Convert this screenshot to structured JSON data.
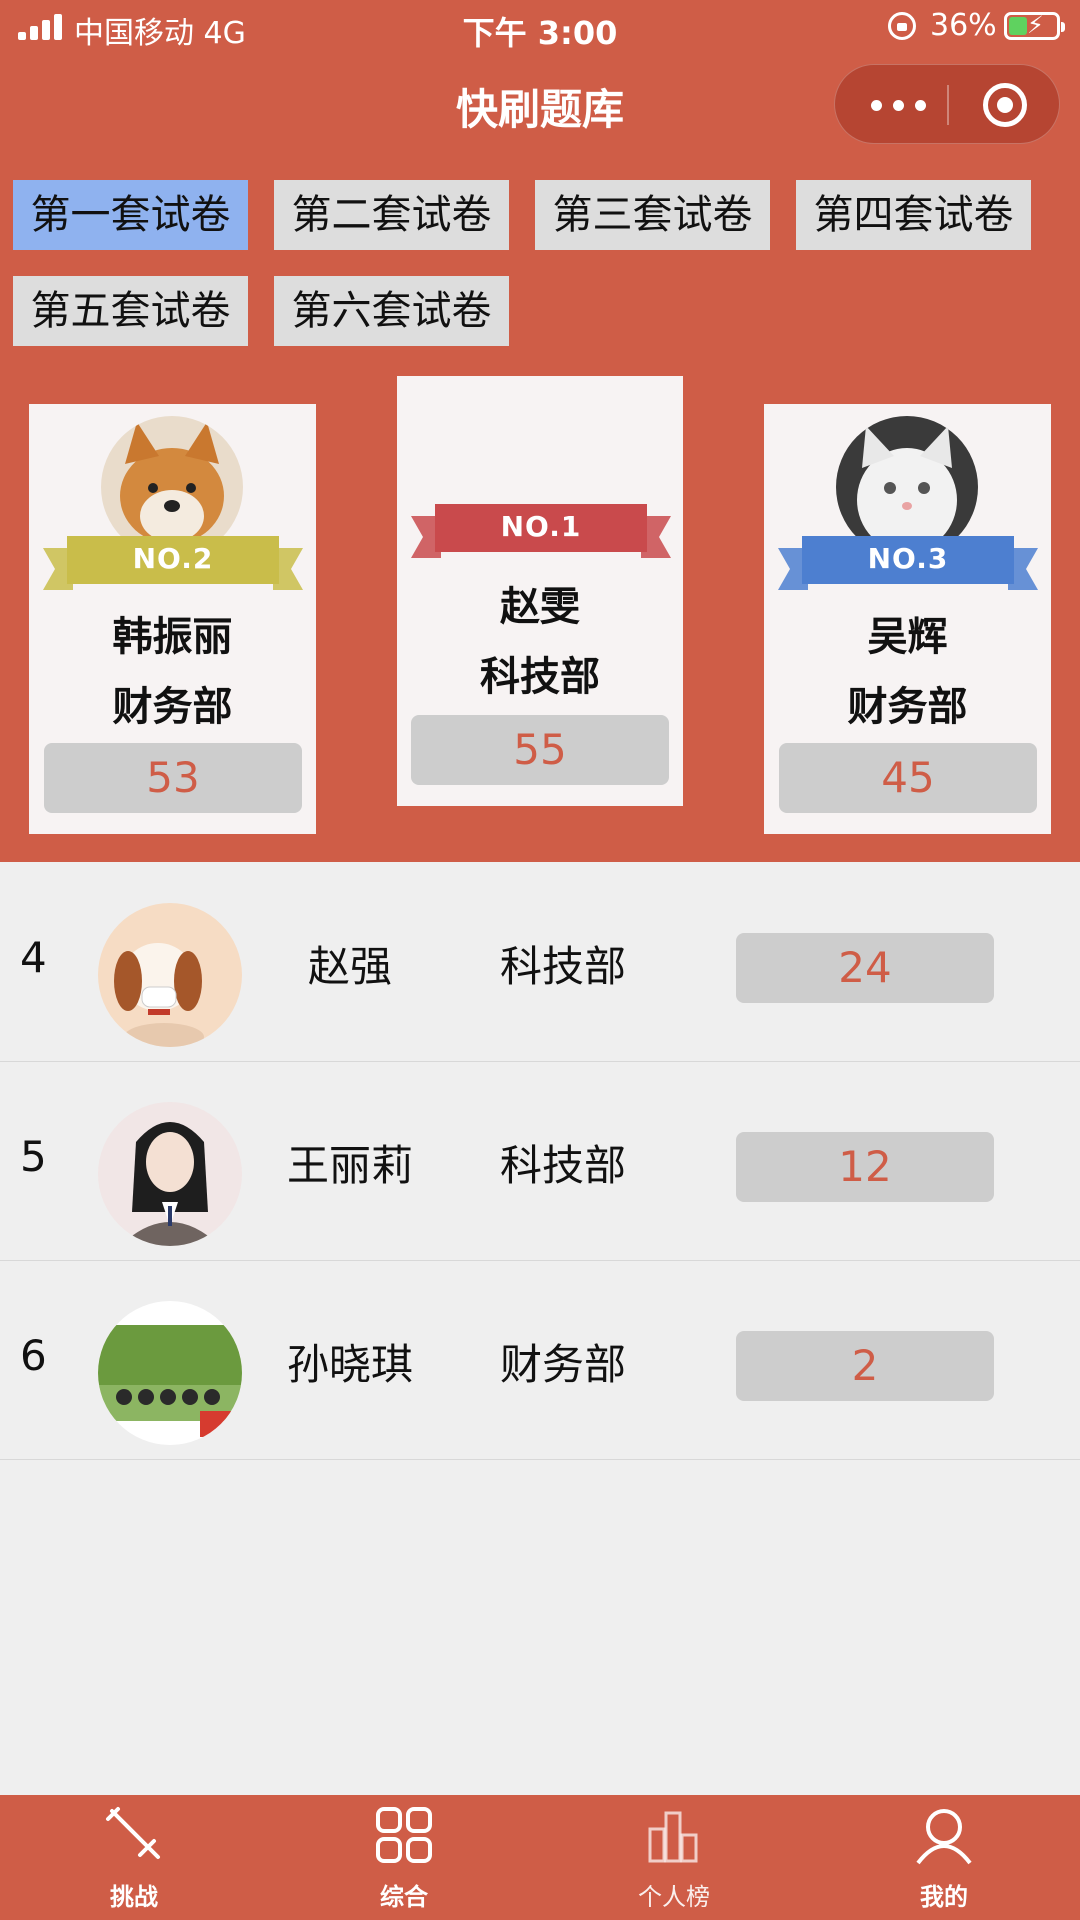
{
  "status_bar": {
    "carrier": "中国移动   4G",
    "time": "下午 3:00",
    "battery": "36%"
  },
  "nav": {
    "title": "快刷题库"
  },
  "paper_tabs": [
    {
      "label": "第一套试卷",
      "active": true
    },
    {
      "label": "第二套试卷",
      "active": false
    },
    {
      "label": "第三套试卷",
      "active": false
    },
    {
      "label": "第四套试卷",
      "active": false
    },
    {
      "label": "第五套试卷",
      "active": false
    },
    {
      "label": "第六套试卷",
      "active": false
    }
  ],
  "podium": {
    "first": {
      "badge": "NO.1",
      "name": "赵雯",
      "dept": "科技部",
      "score": "55",
      "ribbon_color": "#c94a4c"
    },
    "second": {
      "badge": "NO.2",
      "name": "韩振丽",
      "dept": "财务部",
      "score": "53",
      "ribbon_color": "#c9bd4a"
    },
    "third": {
      "badge": "NO.3",
      "name": "吴辉",
      "dept": "财务部",
      "score": "45",
      "ribbon_color": "#4d7fd0"
    }
  },
  "ranking": [
    {
      "rank": "4",
      "name": "赵强",
      "dept": "科技部",
      "score": "24"
    },
    {
      "rank": "5",
      "name": "王丽莉",
      "dept": "科技部",
      "score": "12"
    },
    {
      "rank": "6",
      "name": "孙晓琪",
      "dept": "财务部",
      "score": "2"
    }
  ],
  "tab_bar": {
    "challenge": "挑战",
    "overall": "综合",
    "personal": "个人榜",
    "mine": "我的"
  },
  "colors": {
    "brand": "#cf5d47",
    "active_tab": "#8fb2ef",
    "score_text": "#cf5d47"
  }
}
